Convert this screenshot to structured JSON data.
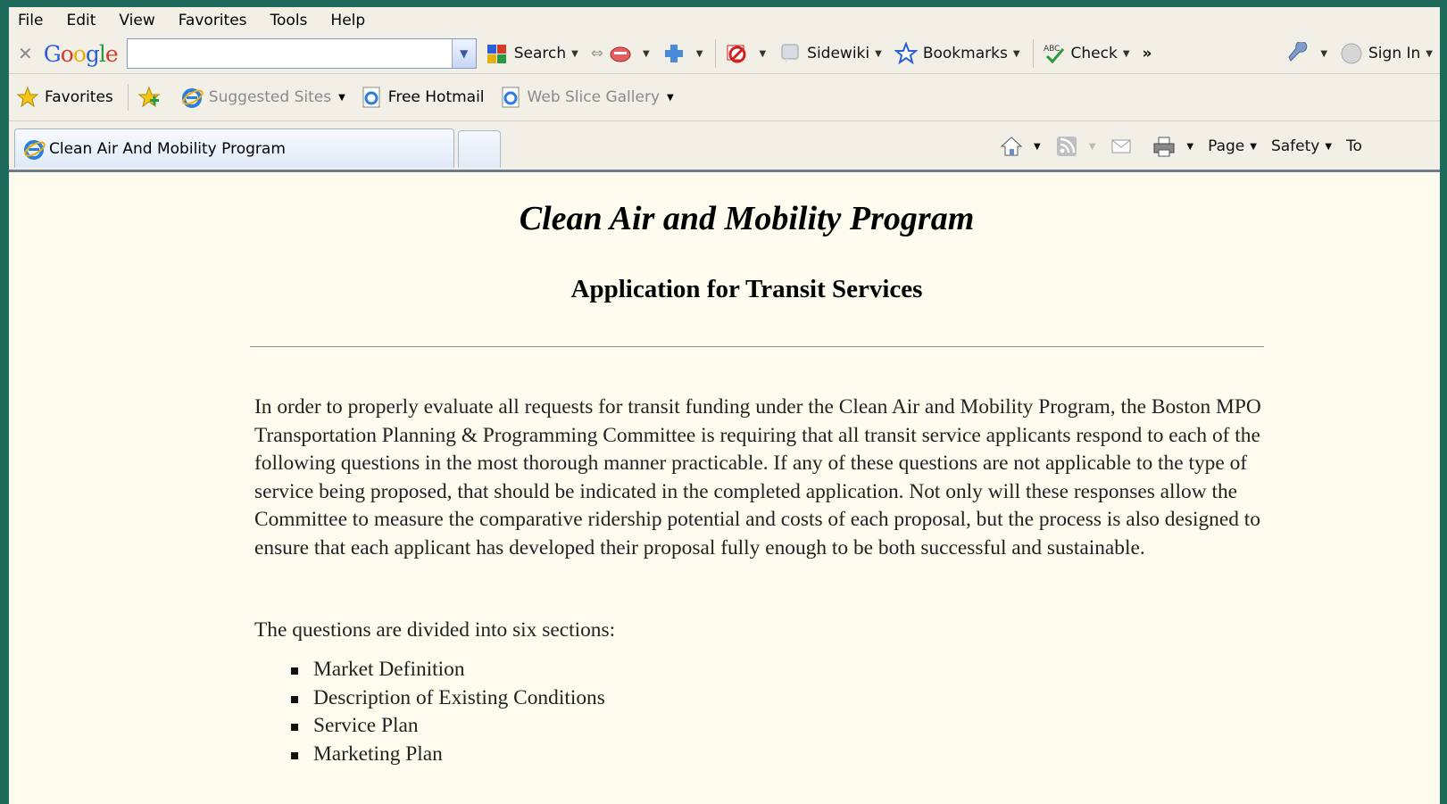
{
  "menubar": {
    "items": [
      "File",
      "Edit",
      "View",
      "Favorites",
      "Tools",
      "Help"
    ]
  },
  "google_toolbar": {
    "logo": "Google",
    "search_value": "",
    "search_label": "Search",
    "sidewiki_label": "Sidewiki",
    "bookmarks_label": "Bookmarks",
    "check_label": "Check",
    "more_label": "»",
    "sign_in_label": "Sign In"
  },
  "favorites_bar": {
    "favorites_label": "Favorites",
    "suggested_sites_label": "Suggested Sites",
    "free_hotmail_label": "Free Hotmail",
    "web_slice_label": "Web Slice Gallery"
  },
  "tab": {
    "title": "Clean Air And Mobility Program"
  },
  "command_bar": {
    "page_label": "Page",
    "safety_label": "Safety",
    "tools_label": "To"
  },
  "page": {
    "title": "Clean Air and Mobility Program",
    "subtitle": "Application for Transit Services",
    "intro": "In order to properly evaluate all requests for transit funding under the Clean Air and Mobility Program, the Boston MPO Transportation Planning & Programming Committee is requiring that all transit service applicants respond to each of the following questions in the most thorough manner practicable. If any of these questions are not applicable to the type of service being proposed, that should be indicated in the completed application. Not only will these responses allow the Committee to measure the comparative ridership potential and costs of each proposal, but the process is also designed to ensure that each applicant has developed their proposal fully enough to be both successful and sustainable.",
    "sections_intro": "The questions are divided into six sections:",
    "sections": [
      "Market Definition",
      "Description of Existing Conditions",
      "Service Plan",
      "Marketing Plan"
    ]
  }
}
